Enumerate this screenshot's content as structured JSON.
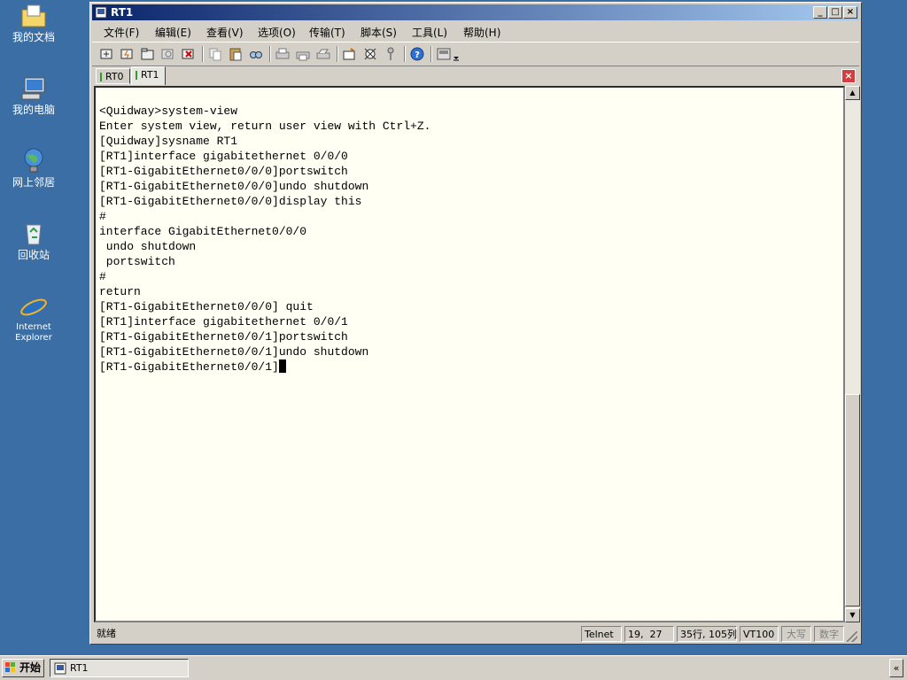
{
  "desktop": {
    "icons": [
      {
        "label": "我的文档",
        "icon": "folder-icon"
      },
      {
        "label": "我的电脑",
        "icon": "computer-icon"
      },
      {
        "label": "网上邻居",
        "icon": "network-icon"
      },
      {
        "label": "回收站",
        "icon": "recycle-bin-icon"
      },
      {
        "label": "Internet Explorer",
        "icon": "ie-icon"
      }
    ]
  },
  "window": {
    "title": "RT1",
    "controls": {
      "minimize": "_",
      "maximize": "□",
      "close": "×"
    },
    "menu": [
      "文件(F)",
      "编辑(E)",
      "查看(V)",
      "选项(O)",
      "传输(T)",
      "脚本(S)",
      "工具(L)",
      "帮助(H)"
    ],
    "toolbar_icons": [
      "connect-icon",
      "quick-connect-icon",
      "connect-tab-icon",
      "reconnect-icon",
      "disconnect-icon",
      "copy-icon",
      "paste-icon",
      "find-icon",
      "print-icon",
      "print-setup-icon",
      "print-screen-icon",
      "session-options-icon",
      "global-options-icon",
      "key-icon",
      "help-icon",
      "sftp-icon"
    ],
    "tabs": [
      {
        "label": "RT0",
        "active": false
      },
      {
        "label": "RT1",
        "active": true
      }
    ],
    "terminal_lines": [
      "<Quidway>system-view",
      "Enter system view, return user view with Ctrl+Z.",
      "[Quidway]sysname RT1",
      "[RT1]interface gigabitethernet 0/0/0",
      "[RT1-GigabitEthernet0/0/0]portswitch",
      "[RT1-GigabitEthernet0/0/0]undo shutdown",
      "[RT1-GigabitEthernet0/0/0]display this",
      "#",
      "interface GigabitEthernet0/0/0",
      " undo shutdown",
      " portswitch",
      "#",
      "return",
      "[RT1-GigabitEthernet0/0/0] quit",
      "[RT1]interface gigabitethernet 0/0/1",
      "[RT1-GigabitEthernet0/0/1]portswitch",
      "[RT1-GigabitEthernet0/0/1]undo shutdown",
      "[RT1-GigabitEthernet0/0/1]"
    ],
    "status": {
      "ready": "就绪",
      "protocol": "Telnet",
      "position": "19,  27",
      "size": "35行, 105列",
      "emulation": "VT100",
      "caps": "大写",
      "num": "数字"
    }
  },
  "taskbar": {
    "start_label": "开始",
    "task_label": "RT1",
    "tray_toggle": "«"
  }
}
